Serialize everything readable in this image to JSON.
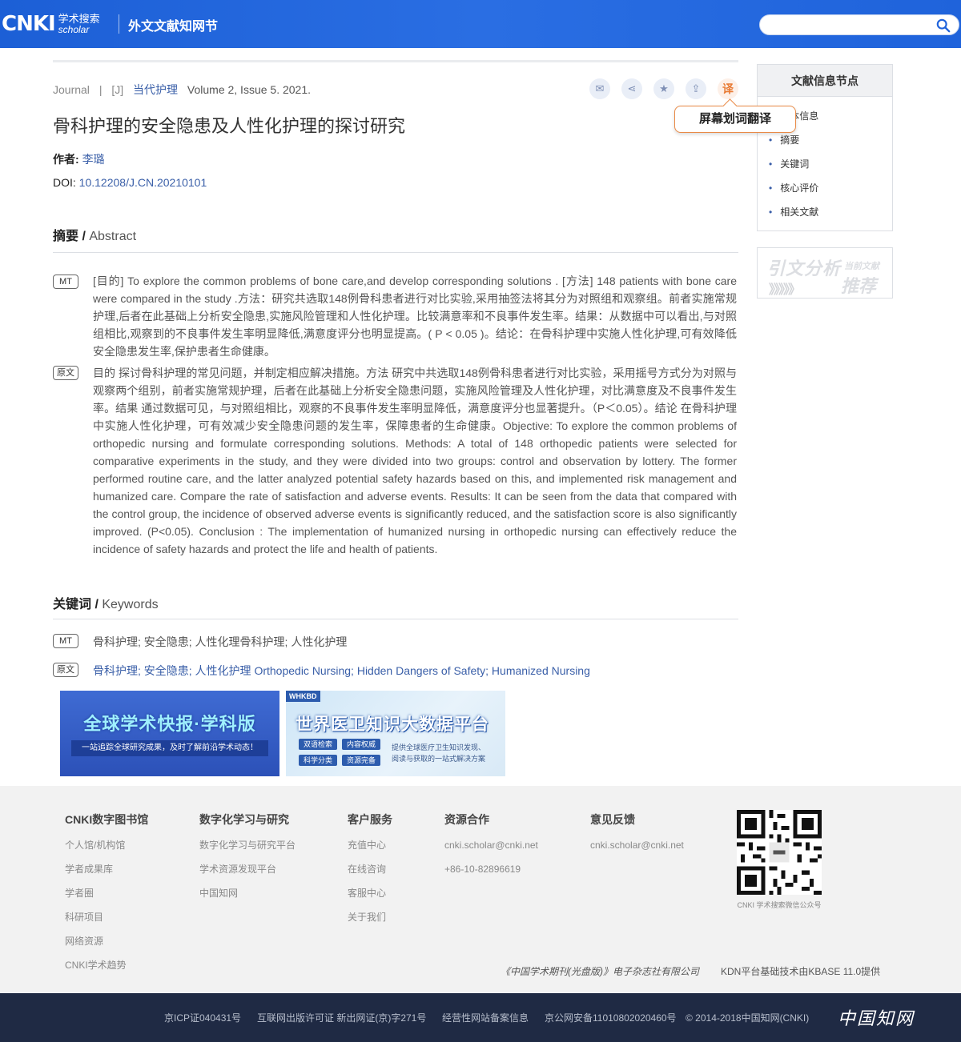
{
  "header": {
    "logo_main": "CNKI",
    "logo_cn": "学术搜索",
    "logo_en": "scholar",
    "site_title": "外文文献知网节",
    "search_value": ""
  },
  "article": {
    "meta_type": "Journal",
    "meta_sep": "|",
    "meta_code": "[J]",
    "journal_name": "当代护理",
    "volume": "Volume 2, Issue 5. 2021.",
    "tools": {
      "mail": "✉",
      "share": "⋖",
      "favorite": "★",
      "export": "⇪",
      "translate": "译"
    },
    "tooltip": "屏幕划词翻译",
    "title": "骨科护理的安全隐患及人性化护理的探讨研究",
    "author_label": "作者: ",
    "author_name": "李璐",
    "doi_label": "DOI: ",
    "doi_value": "10.12208/J.CN.20210101"
  },
  "abstract": {
    "heading_cn": "摘要 / ",
    "heading_en": "Abstract",
    "mt_tag": "MT",
    "mt_text": "[目的] To explore the common problems of bone care,and develop corresponding solutions . [方法] 148 patients with bone care were compared in the study .方法：研究共选取148例骨科患者进行对比实验,采用抽签法将其分为对照组和观察组。前者实施常规护理,后者在此基础上分析安全隐患,实施风险管理和人性化护理。比较满意率和不良事件发生率。结果：从数据中可以看出,与对照组相比,观察到的不良事件发生率明显降低,满意度评分也明显提高。( P < 0.05 )。结论：在骨科护理中实施人性化护理,可有效降低安全隐患发生率,保护患者生命健康。",
    "orig_tag": "原文",
    "orig_text": "目的  探讨骨科护理的常见问题，并制定相应解决措施。方法  研究中共选取148例骨科患者进行对比实验，采用摇号方式分为对照与观察两个组别，前者实施常规护理，后者在此基础上分析安全隐患问题，实施风险管理及人性化护理，对比满意度及不良事件发生率。结果  通过数据可见，与对照组相比，观察的不良事件发生率明显降低，满意度评分也显著提升。（P＜0.05）。结论  在骨科护理中实施人性化护理，可有效减少安全隐患问题的发生率，保障患者的生命健康。Objective: To explore the common problems of orthopedic nursing and formulate corresponding solutions. Methods: A total of 148 orthopedic patients were selected for comparative experiments in the study, and they were divided into two groups: control and observation by lottery. The former performed routine care, and the latter analyzed potential safety hazards based on this, and implemented risk management and humanized care. Compare the rate of satisfaction and adverse events. Results: It can be seen from the data that compared with the control group, the incidence of observed adverse events is significantly reduced, and the satisfaction score is also significantly improved. (P<0.05). Conclusion : The implementation of humanized nursing in orthopedic nursing can effectively reduce the incidence of safety hazards and protect the life and health of patients."
  },
  "keywords": {
    "heading_cn": "关键词 / ",
    "heading_en": "Keywords",
    "mt_tag": "MT",
    "mt_text": "骨科护理; 安全隐患; 人性化理骨科护理; 人性化护理",
    "orig_tag": "原文",
    "orig_text": "骨科护理; 安全隐患; 人性化护理 Orthopedic Nursing; Hidden Dangers of Safety; Humanized Nursing"
  },
  "banners": {
    "b1_title": "全球学术快报·学科版",
    "b1_sub": "一站追踪全球研究成果，及时了解前沿学术动态！",
    "b2_tag": "WHKBD",
    "b2_title": "世界医卫知识大数据平台",
    "b2_pills": [
      "双语检索",
      "内容权威",
      "科学分类",
      "资源完备"
    ],
    "b2_desc1": "提供全球医疗卫生知识发现、",
    "b2_desc2": "阅读与获取的一站式解决方案"
  },
  "sidebar": {
    "title": "文献信息节点",
    "items": [
      "基本信息",
      "摘要",
      "关键词",
      "核心评价",
      "相关文献"
    ],
    "cite_main": "引文分析",
    "cite_small": "当前文献",
    "cite_arrows": "》》》》》",
    "cite_rec": "推荐"
  },
  "footer": {
    "cols": [
      {
        "title": "CNKI数字图书馆",
        "items": [
          "个人馆/机构馆",
          "学者成果库",
          "学者圈",
          "科研项目",
          "网络资源",
          "CNKI学术趋势"
        ]
      },
      {
        "title": "数字化学习与研究",
        "items": [
          "数字化学习与研究平台",
          "学术资源发现平台",
          "中国知网"
        ]
      },
      {
        "title": "客户服务",
        "items": [
          "充值中心",
          "在线咨询",
          "客服中心",
          "关于我们"
        ]
      },
      {
        "title": "资源合作",
        "items": [
          "cnki.scholar@cnki.net",
          "+86-10-82896619"
        ]
      },
      {
        "title": "意见反馈",
        "items": [
          "cnki.scholar@cnki.net"
        ]
      }
    ],
    "qr_caption": "CNKI 学术搜索微信公众号",
    "note1": "《中国学术期刊(光盘版)》电子杂志社有限公司",
    "note2": "KDN平台基础技术由KBASE 11.0提供",
    "bottom_links": [
      "京ICP证040431号",
      "互联网出版许可证 新出网证(京)字271号",
      "经营性网站备案信息",
      "京公网安备11010802020460号",
      "© 2014-2018中国知网(CNKI)"
    ],
    "bottom_logo": "中国知网"
  }
}
